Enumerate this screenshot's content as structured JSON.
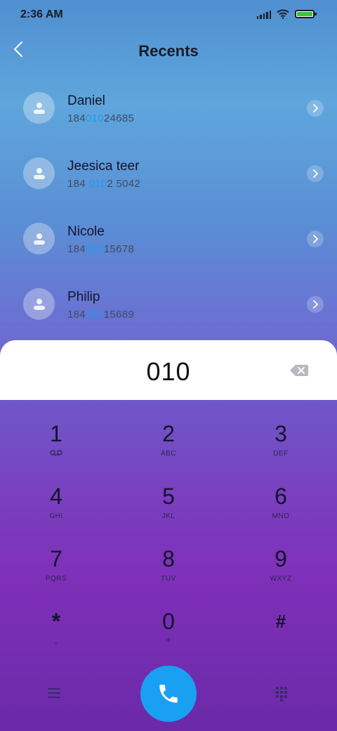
{
  "status_bar": {
    "time": "2:36 AM",
    "icons": [
      "signal-icon",
      "wifi-icon",
      "battery-icon"
    ]
  },
  "header": {
    "title": "Recents",
    "back_icon": "chevron-left-icon"
  },
  "recents": [
    {
      "name": "Daniel",
      "number_prefix": "184",
      "number_match": "010",
      "number_suffix": "24685"
    },
    {
      "name": "Jeesica teer",
      "number_prefix": "184 ",
      "number_match": "010",
      "number_suffix": "2 5042"
    },
    {
      "name": "Nicole",
      "number_prefix": "184",
      "number_match": "010",
      "number_suffix": "15678"
    },
    {
      "name": "Philip",
      "number_prefix": "184",
      "number_match": "010",
      "number_suffix": "15689"
    }
  ],
  "dialer": {
    "input_value": "010",
    "backspace_icon": "backspace-icon"
  },
  "keypad": [
    {
      "digit": "1",
      "letters": "",
      "sub_icon": "voicemail-icon"
    },
    {
      "digit": "2",
      "letters": "ABC"
    },
    {
      "digit": "3",
      "letters": "DEF"
    },
    {
      "digit": "4",
      "letters": "GHI"
    },
    {
      "digit": "5",
      "letters": "JKL"
    },
    {
      "digit": "6",
      "letters": "MNO"
    },
    {
      "digit": "7",
      "letters": "PQRS"
    },
    {
      "digit": "8",
      "letters": "TUV"
    },
    {
      "digit": "9",
      "letters": "WXYZ"
    },
    {
      "digit": "*",
      "letters": ","
    },
    {
      "digit": "0",
      "letters": "+"
    },
    {
      "digit": "#",
      "letters": ""
    }
  ],
  "bottom_bar": {
    "menu_icon": "menu-icon",
    "call_icon": "phone-icon",
    "dialpad_icon": "dialpad-icon"
  },
  "colors": {
    "accent": "#1aa0f2",
    "highlight": "#1e9bf0",
    "panel": "#ffffff"
  }
}
